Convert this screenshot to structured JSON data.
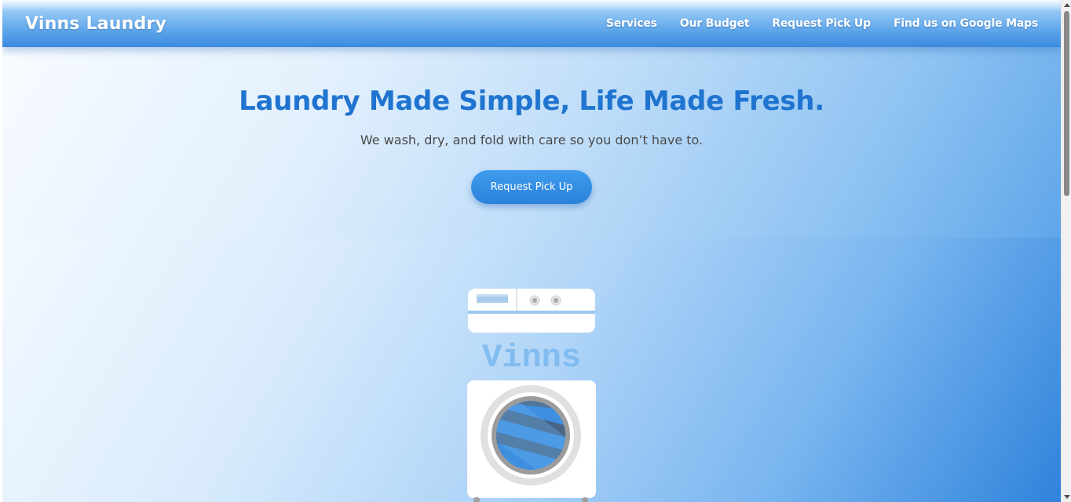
{
  "header": {
    "brand": "Vinns Laundry",
    "nav": [
      {
        "label": "Services"
      },
      {
        "label": "Our Budget"
      },
      {
        "label": "Request Pick Up"
      },
      {
        "label": "Find us on Google Maps"
      }
    ]
  },
  "hero": {
    "title": "Laundry Made Simple, Life Made Fresh.",
    "subtitle": "We wash, dry, and fold with care so you don’t have to.",
    "cta_label": "Request Pick Up"
  },
  "showcase": {
    "machine_label": "Vinns"
  },
  "colors": {
    "accent": "#1f74cf",
    "button": "#2a82da",
    "nav_gradient_bottom": "#3b8ade"
  },
  "icons": {
    "machine": "washing-machine-illustration"
  }
}
